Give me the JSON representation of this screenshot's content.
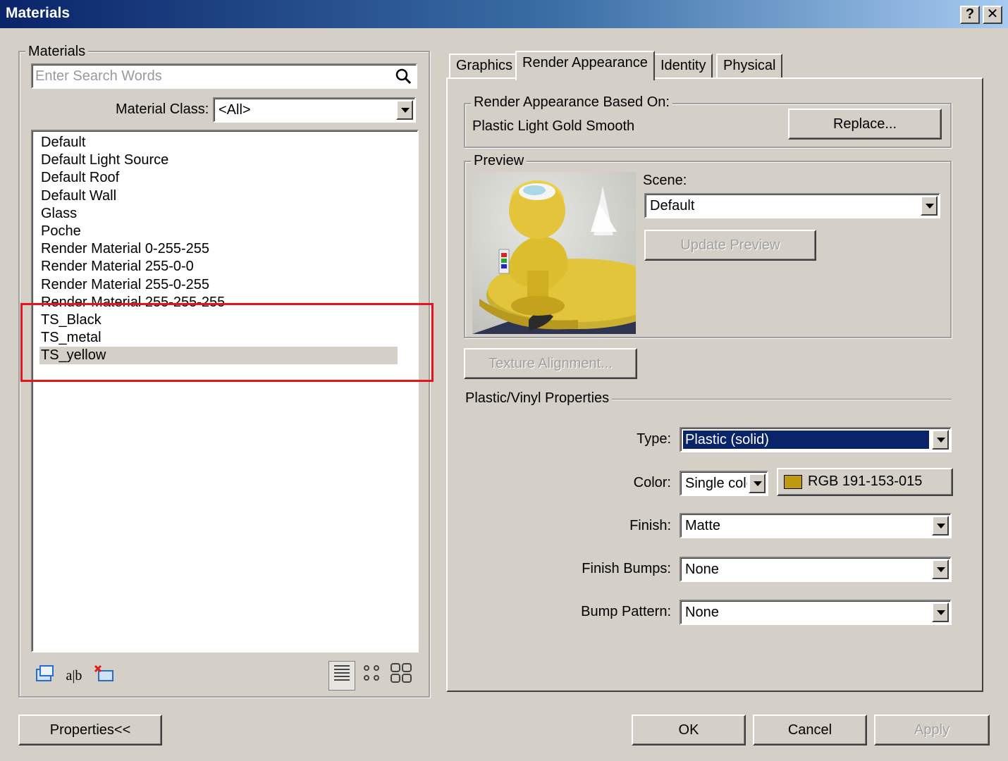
{
  "window": {
    "title": "Materials",
    "help_glyph": "?",
    "close_glyph": "✕"
  },
  "materials_group": {
    "legend": "Materials",
    "search_placeholder": "Enter Search Words",
    "class_label": "Material Class:",
    "class_value": "<All>",
    "items": [
      "Default",
      "Default Light Source",
      "Default Roof",
      "Default Wall",
      "Glass",
      "Poche",
      "Render Material 0-255-255",
      "Render Material 255-0-0",
      "Render Material 255-0-255",
      "Render Material 255-255-255",
      "TS_Black",
      "TS_metal",
      "TS_yellow"
    ],
    "selected_index": 12,
    "rename_glyph": "a|b"
  },
  "tabs": [
    "Graphics",
    "Render Appearance",
    "Identity",
    "Physical"
  ],
  "active_tab": 1,
  "render_appearance": {
    "based_on_legend": "Render Appearance Based On:",
    "based_on_value": "Plastic Light Gold Smooth",
    "replace_label": "Replace...",
    "preview_legend": "Preview",
    "scene_label": "Scene:",
    "scene_value": "Default",
    "update_preview_label": "Update Preview",
    "texture_alignment_label": "Texture Alignment...",
    "properties_heading": "Plastic/Vinyl Properties",
    "type_label": "Type:",
    "type_value": "Plastic (solid)",
    "color_label": "Color:",
    "color_mode_value": "Single colo",
    "color_swatch": "#bf990f",
    "color_rgb_label": "RGB 191-153-015",
    "finish_label": "Finish:",
    "finish_value": "Matte",
    "finish_bumps_label": "Finish Bumps:",
    "finish_bumps_value": "None",
    "bump_pattern_label": "Bump Pattern:",
    "bump_pattern_value": "None"
  },
  "footer": {
    "properties_label": "Properties<<",
    "ok_label": "OK",
    "cancel_label": "Cancel",
    "apply_label": "Apply"
  },
  "colors": {
    "highlight_border": "#e8141b",
    "selection_blue": "#0a246a",
    "title_start": "#0a246a"
  }
}
